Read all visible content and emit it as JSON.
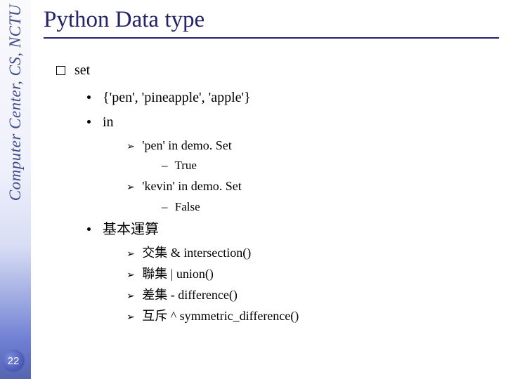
{
  "sidebar_text": "Computer Center, CS, NCTU",
  "page_number": "22",
  "title": "Python Data type",
  "section": {
    "heading": "set",
    "bullets": [
      {
        "text": "{'pen', 'pineapple', 'apple'}"
      },
      {
        "text": "in",
        "subs": [
          {
            "text": "'pen' in demo. Set",
            "result": "True"
          },
          {
            "text": "'kevin' in demo. Set",
            "result": "False"
          }
        ]
      },
      {
        "text": "基本運算",
        "ops": [
          "交集  &  intersection()",
          "聯集  |  union()",
          "差集  -  difference()",
          "互斥  ^  symmetric_difference()"
        ]
      }
    ]
  }
}
